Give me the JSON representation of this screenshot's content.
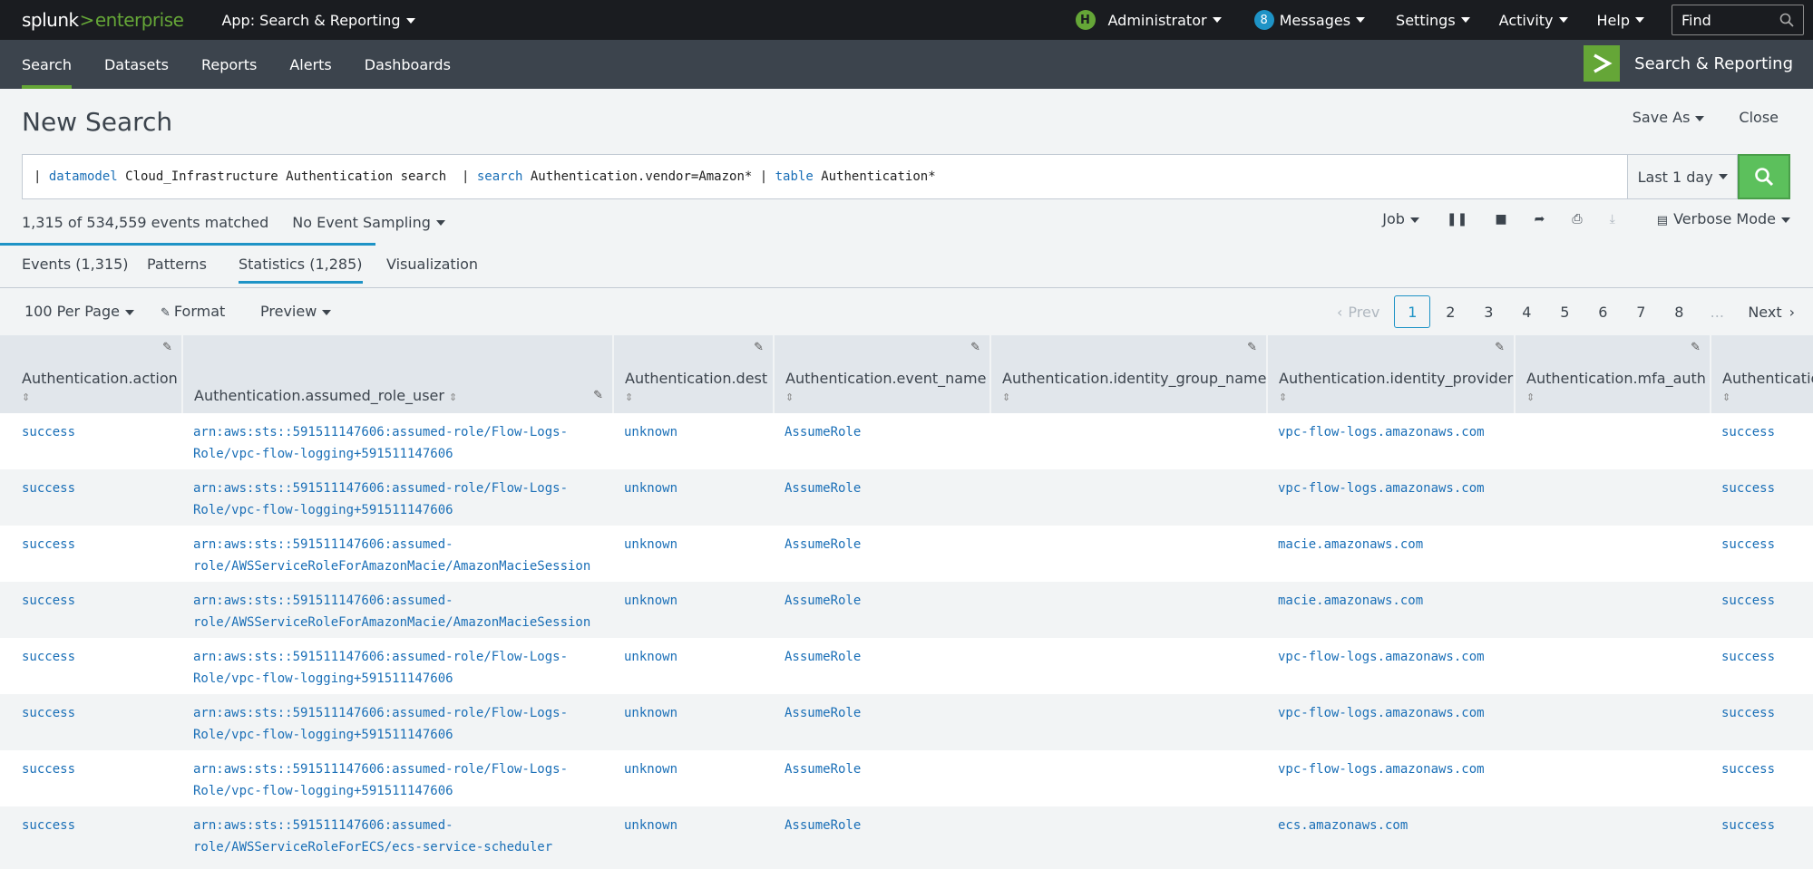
{
  "topbar": {
    "brand_a": "splunk",
    "brand_gt": ">",
    "brand_b": "enterprise",
    "app_menu": "App: Search & Reporting",
    "user_initial": "H",
    "user": "Administrator",
    "messages_count": "8",
    "messages": "Messages",
    "settings": "Settings",
    "activity": "Activity",
    "help": "Help",
    "find_placeholder": "Find"
  },
  "nav": {
    "tabs": [
      "Search",
      "Datasets",
      "Reports",
      "Alerts",
      "Dashboards"
    ],
    "app_name": "Search & Reporting"
  },
  "page": {
    "title": "New Search",
    "save_as": "Save As",
    "close": "Close"
  },
  "search": {
    "pipe1": "| ",
    "kw1": "datamodel",
    "text1": " Cloud_Infrastructure Authentication search  | ",
    "kw2": "search",
    "text2": " Authentication.vendor=Amazon* | ",
    "kw3": "table",
    "text3": " Authentication*",
    "time_range": "Last 1 day"
  },
  "status": {
    "matched": "1,315 of 534,559 events matched",
    "sampling": "No Event Sampling",
    "job": "Job",
    "mode": "Verbose Mode"
  },
  "subtabs": {
    "events": "Events (1,315)",
    "patterns": "Patterns",
    "statistics": "Statistics (1,285)",
    "visualization": "Visualization"
  },
  "toolbar": {
    "per_page": "100 Per Page",
    "format": "Format",
    "preview": "Preview",
    "prev": "Prev",
    "next": "Next",
    "pages": [
      "1",
      "2",
      "3",
      "4",
      "5",
      "6",
      "7",
      "8"
    ],
    "ellipsis": "..."
  },
  "table": {
    "columns": [
      "Authentication.action",
      "Authentication.assumed_role_user",
      "Authentication.dest",
      "Authentication.event_name",
      "Authentication.identity_group_name",
      "Authentication.identity_provider",
      "Authentication.mfa_auth",
      "Authenticatio"
    ],
    "rows": [
      [
        "success",
        "arn:aws:sts::591511147606:assumed-role/Flow-Logs-Role/vpc-flow-logging+591511147606",
        "unknown",
        "AssumeRole",
        "",
        "vpc-flow-logs.amazonaws.com",
        "",
        "success"
      ],
      [
        "success",
        "arn:aws:sts::591511147606:assumed-role/Flow-Logs-Role/vpc-flow-logging+591511147606",
        "unknown",
        "AssumeRole",
        "",
        "vpc-flow-logs.amazonaws.com",
        "",
        "success"
      ],
      [
        "success",
        "arn:aws:sts::591511147606:assumed-role/AWSServiceRoleForAmazonMacie/AmazonMacieSession",
        "unknown",
        "AssumeRole",
        "",
        "macie.amazonaws.com",
        "",
        "success"
      ],
      [
        "success",
        "arn:aws:sts::591511147606:assumed-role/AWSServiceRoleForAmazonMacie/AmazonMacieSession",
        "unknown",
        "AssumeRole",
        "",
        "macie.amazonaws.com",
        "",
        "success"
      ],
      [
        "success",
        "arn:aws:sts::591511147606:assumed-role/Flow-Logs-Role/vpc-flow-logging+591511147606",
        "unknown",
        "AssumeRole",
        "",
        "vpc-flow-logs.amazonaws.com",
        "",
        "success"
      ],
      [
        "success",
        "arn:aws:sts::591511147606:assumed-role/Flow-Logs-Role/vpc-flow-logging+591511147606",
        "unknown",
        "AssumeRole",
        "",
        "vpc-flow-logs.amazonaws.com",
        "",
        "success"
      ],
      [
        "success",
        "arn:aws:sts::591511147606:assumed-role/Flow-Logs-Role/vpc-flow-logging+591511147606",
        "unknown",
        "AssumeRole",
        "",
        "vpc-flow-logs.amazonaws.com",
        "",
        "success"
      ],
      [
        "success",
        "arn:aws:sts::591511147606:assumed-role/AWSServiceRoleForECS/ecs-service-scheduler",
        "unknown",
        "AssumeRole",
        "",
        "ecs.amazonaws.com",
        "",
        "success"
      ]
    ]
  },
  "colors": {
    "accent_green": "#65a637",
    "link_blue": "#1a6fb7",
    "tab_blue": "#1e93c6"
  }
}
